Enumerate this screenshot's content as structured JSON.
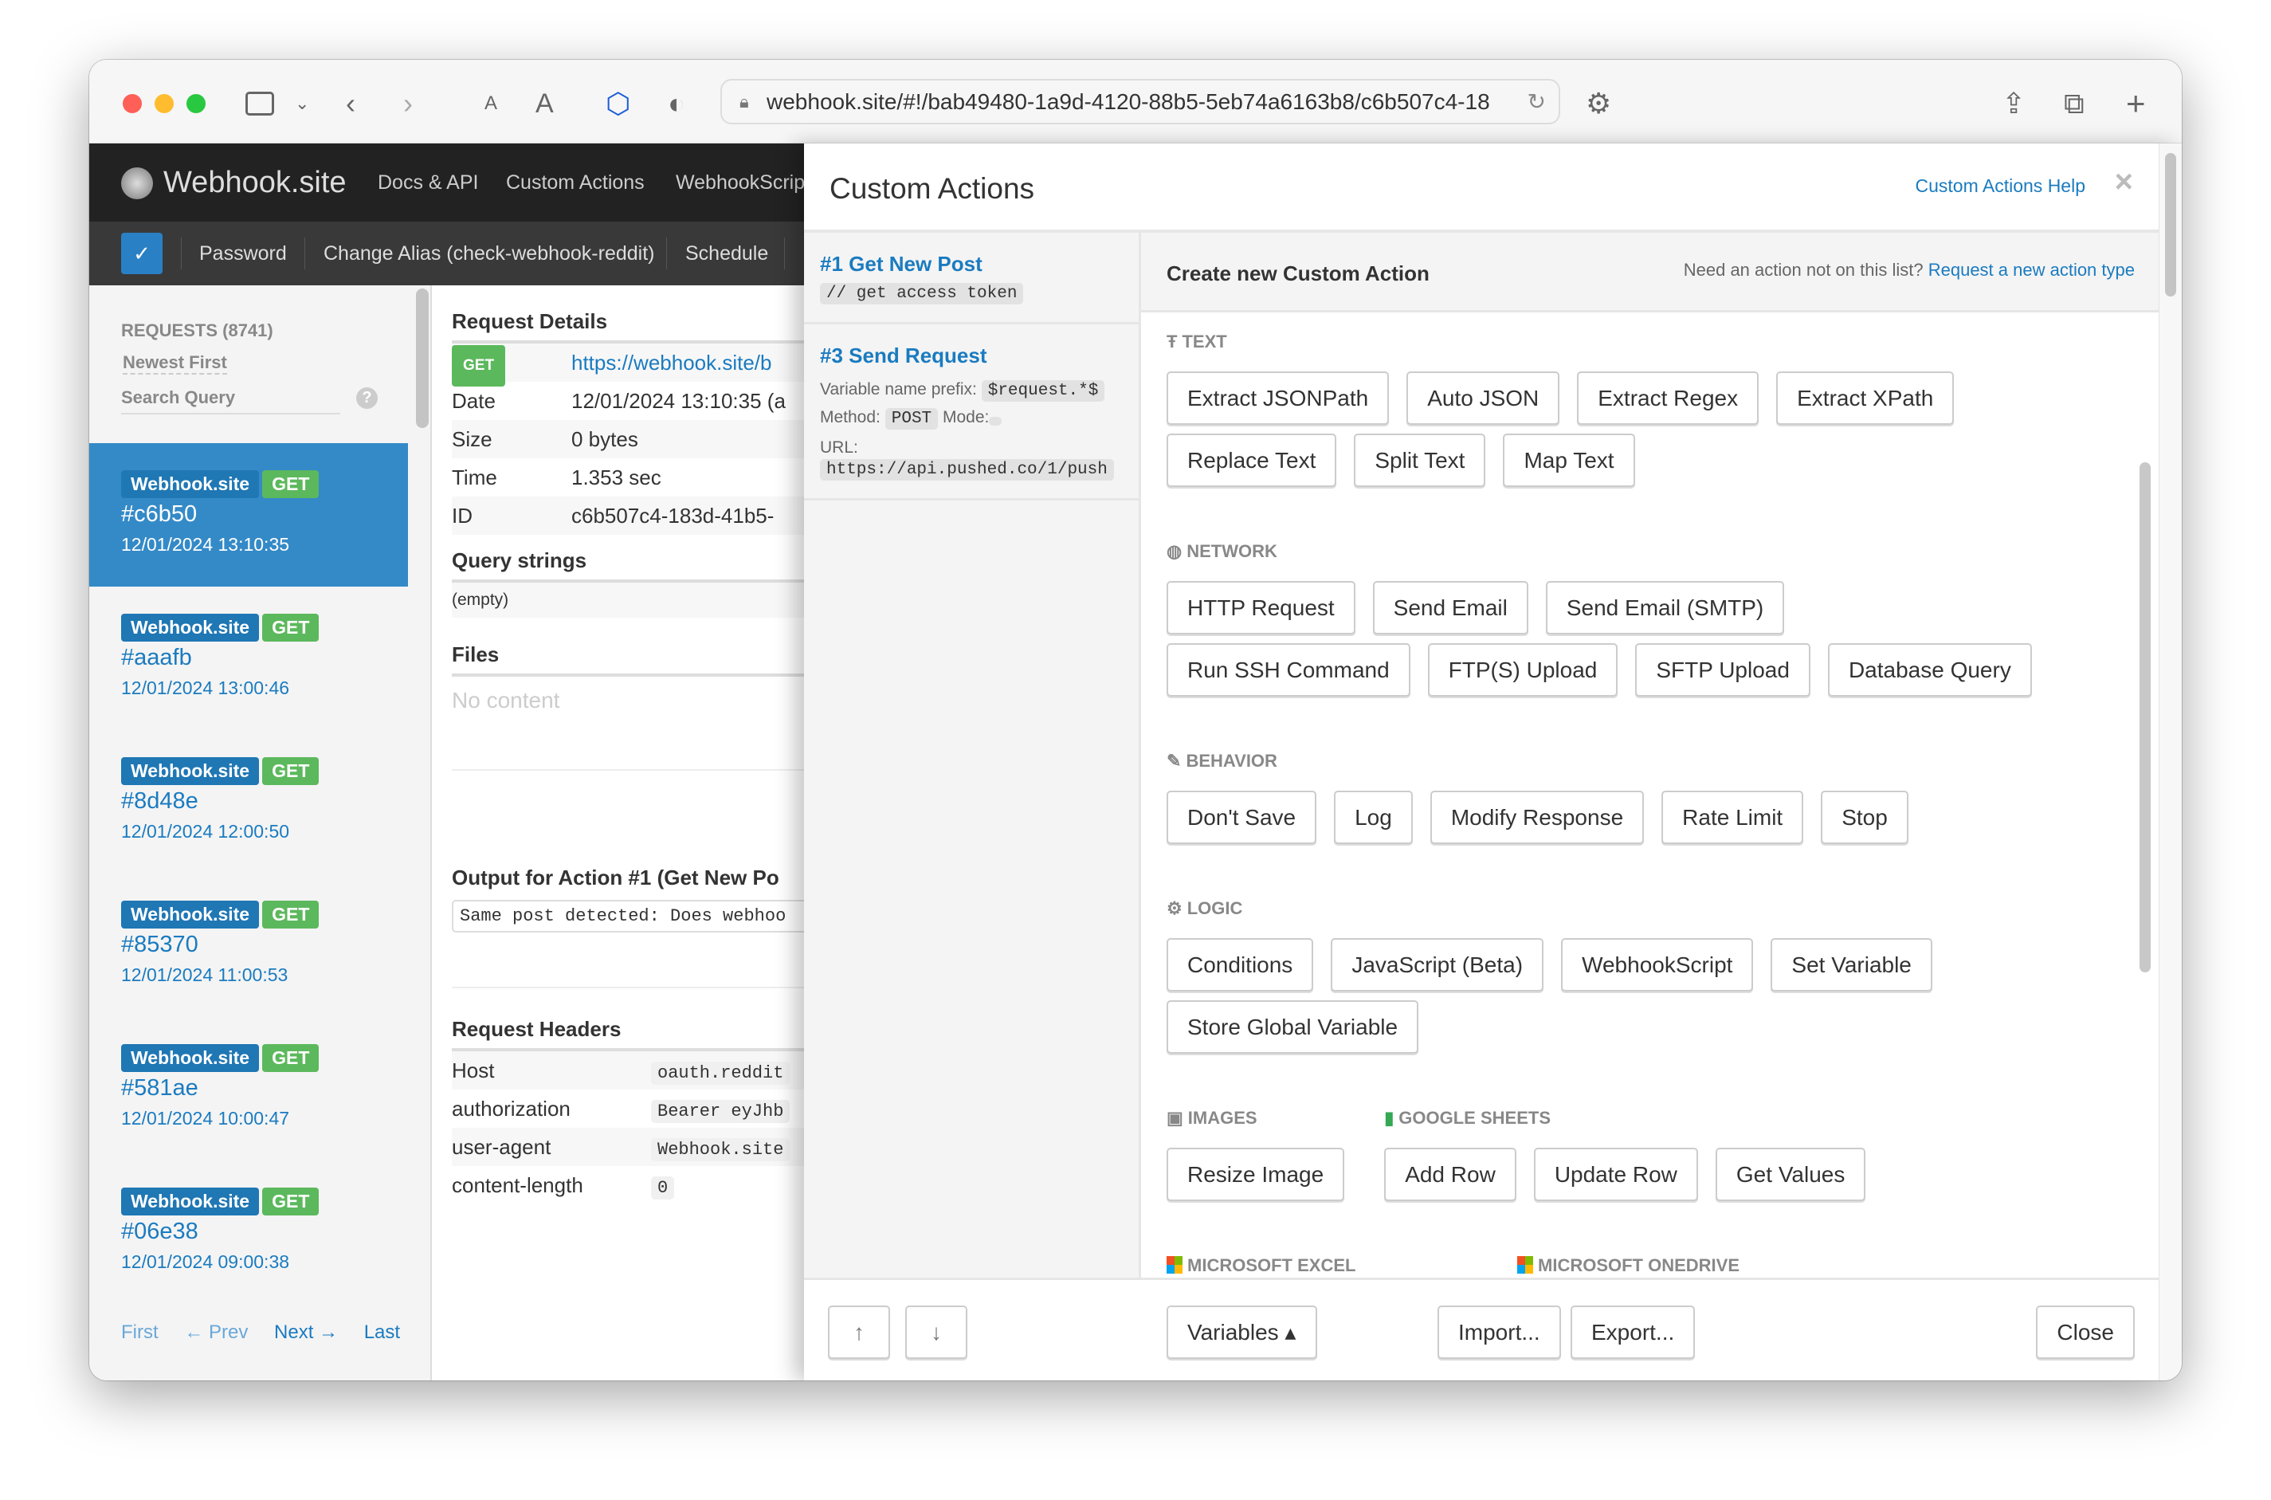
{
  "browser": {
    "url": "webhook.site/#!/bab49480-1a9d-4120-88b5-5eb74a6163b8/c6b507c4-18",
    "icons": [
      "sidebar-icon",
      "chevron-down-icon",
      "back-icon",
      "forward-icon",
      "text-smaller-icon",
      "text-larger-icon",
      "extension-icon",
      "shield-icon",
      "lock-icon",
      "reload-icon",
      "gear-icon",
      "share-icon",
      "tabs-icon",
      "new-tab-icon"
    ],
    "text_small": "A",
    "text_large": "A"
  },
  "nav": {
    "logo": "Webhook.site",
    "links": [
      "Docs & API",
      "Custom Actions",
      "WebhookScript"
    ],
    "sub": [
      "Password",
      "Change Alias (check-webhook-reddit)",
      "Schedule"
    ]
  },
  "sidebar": {
    "title": "REQUESTS (8741)",
    "sort": "Newest First",
    "search_placeholder": "Search Query",
    "requests": [
      {
        "source": "Webhook.site",
        "method": "GET",
        "id": "#c6b50",
        "date": "12/01/2024 13:10:35",
        "selected": true
      },
      {
        "source": "Webhook.site",
        "method": "GET",
        "id": "#aaafb",
        "date": "12/01/2024 13:00:46"
      },
      {
        "source": "Webhook.site",
        "method": "GET",
        "id": "#8d48e",
        "date": "12/01/2024 12:00:50"
      },
      {
        "source": "Webhook.site",
        "method": "GET",
        "id": "#85370",
        "date": "12/01/2024 11:00:53"
      },
      {
        "source": "Webhook.site",
        "method": "GET",
        "id": "#581ae",
        "date": "12/01/2024 10:00:47"
      },
      {
        "source": "Webhook.site",
        "method": "GET",
        "id": "#06e38",
        "date": "12/01/2024 09:00:38"
      }
    ],
    "pager": {
      "first": "First",
      "prev": "← Prev",
      "next": "Next →",
      "last": "Last"
    }
  },
  "details": {
    "title": "Request Details",
    "method": "GET",
    "url": "https://webhook.site/b",
    "rows": [
      {
        "k": "Date",
        "v": "12/01/2024 13:10:35 (a"
      },
      {
        "k": "Size",
        "v": "0 bytes"
      },
      {
        "k": "Time",
        "v": "1.353 sec"
      },
      {
        "k": "ID",
        "v": "c6b507c4-183d-41b5-"
      }
    ],
    "query_title": "Query strings",
    "query_empty": "(empty)",
    "files_title": "Files",
    "files_empty": "No content",
    "output_title": "Output for Action #1 (Get New Po",
    "output_text": "Same post detected: Does webhoo",
    "headers_title": "Request Headers",
    "headers": [
      {
        "k": "Host",
        "v": "oauth.reddit"
      },
      {
        "k": "authorization",
        "v": "Bearer eyJhb"
      },
      {
        "k": "user-agent",
        "v": "Webhook.site"
      },
      {
        "k": "content-length",
        "v": "0"
      }
    ]
  },
  "panel": {
    "title": "Custom Actions",
    "help": "Custom Actions Help",
    "close_x": "×",
    "actions": [
      {
        "title": "#1 Get New Post",
        "code": "// get access token"
      },
      {
        "title": "#3 Send Request",
        "prefix_label": "Variable name prefix:",
        "prefix": "$request.*$",
        "method_label": "Method:",
        "method": "POST",
        "mode_label": "Mode:",
        "url_label": "URL:",
        "url": "https://api.pushed.co/1/push"
      }
    ],
    "create_title": "Create new Custom Action",
    "need_text": "Need an action not on this list?",
    "request_link": "Request a new action type",
    "sections": [
      {
        "label": "TEXT",
        "icon": "text-icon",
        "buttons": [
          "Extract JSONPath",
          "Auto JSON",
          "Extract Regex",
          "Extract XPath",
          "Replace Text",
          "Split Text",
          "Map Text"
        ]
      },
      {
        "label": "NETWORK",
        "icon": "globe-icon",
        "buttons": [
          "HTTP Request",
          "Send Email",
          "Send Email (SMTP)",
          "Run SSH Command",
          "FTP(S) Upload",
          "SFTP Upload",
          "Database Query"
        ]
      },
      {
        "label": "BEHAVIOR",
        "icon": "edit-icon",
        "buttons": [
          "Don't Save",
          "Log",
          "Modify Response",
          "Rate Limit",
          "Stop"
        ]
      },
      {
        "label": "LOGIC",
        "icon": "cog-icon",
        "buttons": [
          "Conditions",
          "JavaScript (Beta)",
          "WebhookScript",
          "Set Variable",
          "Store Global Variable"
        ]
      },
      {
        "label": "IMAGES",
        "icon": "image-icon",
        "buttons": [
          "Resize Image"
        ]
      },
      {
        "label": "GOOGLE SHEETS",
        "icon": "google-sheets-icon",
        "buttons": [
          "Add Row",
          "Update Row",
          "Get Values"
        ]
      },
      {
        "label": "MICROSOFT EXCEL",
        "icon": "microsoft-icon",
        "buttons": []
      },
      {
        "label": "MICROSOFT ONEDRIVE",
        "icon": "microsoft-icon",
        "buttons": []
      }
    ],
    "footer": {
      "up": "↑",
      "down": "↓",
      "variables": "Variables ▴",
      "import": "Import...",
      "export": "Export...",
      "close": "Close"
    }
  }
}
